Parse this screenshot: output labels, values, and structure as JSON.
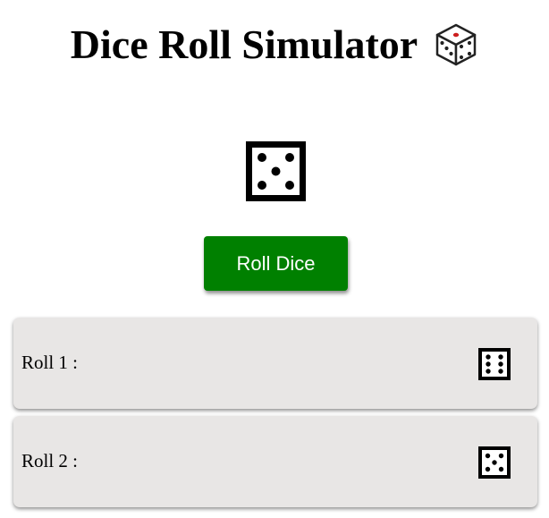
{
  "header": {
    "title": "Dice Roll Simulator",
    "icon": "die-emoji-icon"
  },
  "main_die": {
    "face": 5,
    "icon": "die-face-5-icon"
  },
  "roll_button": {
    "label": "Roll Dice",
    "color": "#008000"
  },
  "history": {
    "rolls": [
      {
        "label": "Roll 1 :",
        "face": 6,
        "icon": "die-face-6-icon"
      },
      {
        "label": "Roll 2 :",
        "face": 5,
        "icon": "die-face-5-icon"
      }
    ]
  },
  "colors": {
    "card_background": "#e8e6e5",
    "button_text": "#ffffff"
  }
}
